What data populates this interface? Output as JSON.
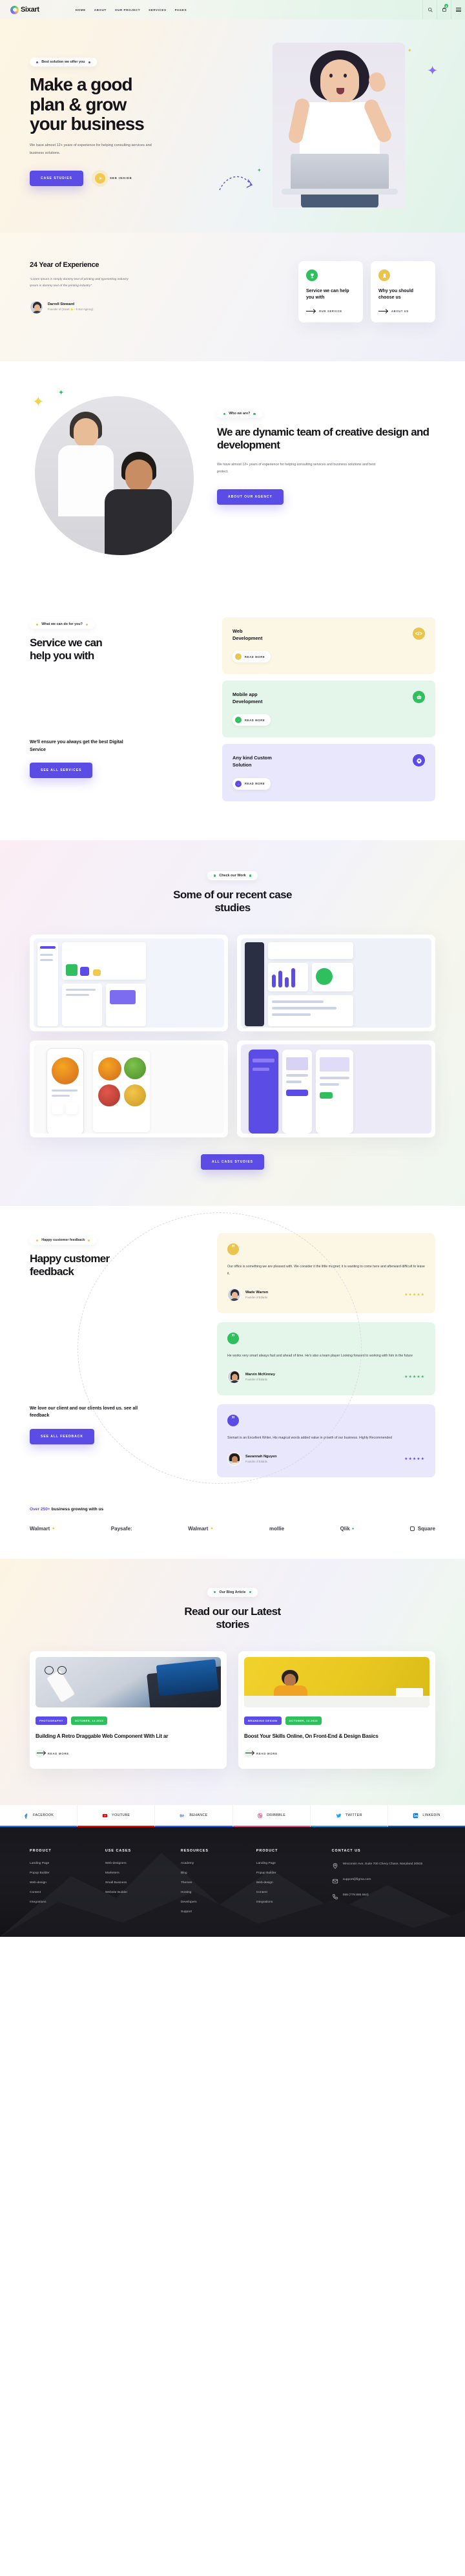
{
  "header": {
    "brand": "Sixart",
    "nav": [
      "HOME",
      "ABOUT",
      "OUR PROJECT",
      "SERVICES",
      "PAGES"
    ],
    "cart_count": "0"
  },
  "hero": {
    "badge": "Best solution we offer you",
    "title_line1": "Make a good",
    "title_line2": "plan & grow",
    "title_line3": "your business",
    "description": "We have almost 12+ years of experience for helping consulting services and business solutions.",
    "primary_button": "CASE STUDIES",
    "play_label": "SEE INSIDE"
  },
  "experience": {
    "title": "24 Year of Experience",
    "quote": "“Lorem Ipsum is simply dummy text of printing and typesetting industry Ipsum is dummy text of the printing industry”",
    "person_name": "Darrell Steward",
    "person_role": "Founder of (Sixart ⭐ - 5 star Agency)",
    "cards": [
      {
        "title": "Service we can help you with",
        "link": "OUR SERVICE",
        "color": "green"
      },
      {
        "title": "Why you should choose us",
        "link": "ABOUT US",
        "color": "yellow"
      }
    ]
  },
  "about": {
    "badge": "Who we are?",
    "title": "We are dynamic team of creative design and development",
    "description": "We have almost 12+ years of experience for helping consulting services and business solutions and best protect.",
    "button": "ABOUT OUR AGENCY"
  },
  "services": {
    "badge": "What we can do for you?",
    "title_line1": "Service we can",
    "title_line2": "help you with",
    "bottom_title": "We'll ensure you always get the best Digital Service",
    "bottom_button": "SEE ALL SERVICES",
    "cards": [
      {
        "name_line1": "Web",
        "name_line2": "Development",
        "read_more": "READ MORE",
        "color": "#e9c44f"
      },
      {
        "name_line1": "Mobile app",
        "name_line2": "Development",
        "read_more": "READ MORE",
        "color": "#2fbf5e"
      },
      {
        "name_line1": "Any kind Custom",
        "name_line2": "Solution",
        "read_more": "READ MORE",
        "color": "#5b4ce6"
      }
    ]
  },
  "cases": {
    "badge": "Check our Work",
    "title_line1": "Some of our recent case",
    "title_line2": "studies",
    "button": "ALL CASE STUDIES"
  },
  "feedback": {
    "badge": "Happy customer feedback",
    "title_line1": "Happy customer",
    "title_line2": "feedback",
    "bottom_title": "We love our client and our clients loved us. see all feedback",
    "bottom_button": "SEE ALL FEEDBACK",
    "testimonials": [
      {
        "text": "Our office is something we are pleased with. We consider it the little magnet; it is wanting to come here and afterward difficult to leave it.",
        "name": "Wade Warren",
        "role": "Founder of Edardx",
        "stars": "★★★★★",
        "color": "#e9c44f"
      },
      {
        "text": "He works very smart always fast and ahead of time. He's also a team player Looking forward to working with him in the future",
        "name": "Marvin McKinney",
        "role": "Founder of Edardx",
        "stars": "★★★★★",
        "color": "#2fbf5e"
      },
      {
        "text": "Sixmart is an Excellent Writer, His magical words added value in growth of our business. Highly Recommended",
        "name": "Savannah Nguyen",
        "role": "Founder of Edardx",
        "stars": "★★★★★",
        "color": "#5b4ce6"
      }
    ]
  },
  "brands": {
    "heading_accent": "Over 250+",
    "heading_rest": " business growing with us",
    "items": [
      "Walmart",
      "Paysafe:",
      "Walmart",
      "mollie",
      "Qlik",
      "Square"
    ]
  },
  "blog": {
    "badge": "Our Blog Article",
    "title_line1": "Read our our Latest",
    "title_line2": "stories",
    "posts": [
      {
        "tag1": "PHOTOGRAPHY",
        "tag2": "OCTOBER, 12.2022",
        "title": "Building A Retro Draggable Web Component With Lit ar",
        "read_more": "READ MORE"
      },
      {
        "tag1": "BRANDING DESIGN",
        "tag2": "OCTOBER, 12.2022",
        "title": "Boost Your Skills Online, On Front-End & Design Basics",
        "read_more": "READ MORE"
      }
    ]
  },
  "social": [
    {
      "label": "FACEBOOK",
      "color": "#1877f2"
    },
    {
      "label": "YOUTUBE",
      "color": "#ff0000"
    },
    {
      "label": "BEHANCE",
      "color": "#1769ff"
    },
    {
      "label": "DRIBBBLE",
      "color": "#ea4c89"
    },
    {
      "label": "TWITTER",
      "color": "#1da1f2"
    },
    {
      "label": "LINKEDIN",
      "color": "#0a66c2"
    }
  ],
  "footer": {
    "columns": [
      {
        "heading": "PRODUCT",
        "links": [
          "Landing Page",
          "Popup Builder",
          "Web-design",
          "Content",
          "Integrations"
        ]
      },
      {
        "heading": "USE CASES",
        "links": [
          "Web-designers",
          "Marketers",
          "Small Business",
          "Website Builder"
        ]
      },
      {
        "heading": "RESOURCES",
        "links": [
          "Academy",
          "Blog",
          "Themes",
          "Hosting",
          "Developers",
          "Support"
        ]
      },
      {
        "heading": "PRODUCT",
        "links": [
          "Landing Page",
          "Popup Builder",
          "Web-design",
          "Content",
          "Integrations"
        ]
      }
    ],
    "contact_heading": "CONTACT US",
    "address": "Wisconsin Ave, Suite 700 Chevy Chase, Maryland 20815",
    "email": "support@figma.com",
    "phone": "088 (778 886 664)"
  }
}
